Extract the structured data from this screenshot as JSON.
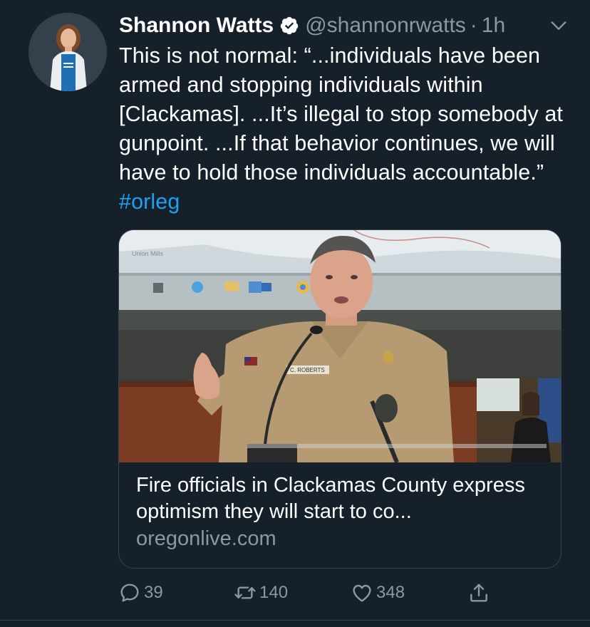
{
  "author": {
    "display_name": "Shannon Watts",
    "handle": "@shannonrwatts",
    "separator": "·",
    "time": "1h",
    "verified": true
  },
  "tweet": {
    "text_before": "This is not normal: “...individuals have been armed and stopping individuals within [Clackamas]. ...It’s illegal to stop somebody at gunpoint. ...If that behavior continues, we will have to hold those individuals accountable.” ",
    "hashtag": "#orleg"
  },
  "card": {
    "image_map_label": "Union Mills",
    "image_nametag": "C. ROBERTS",
    "title": "Fire officials in Clackamas County express optimism they will start to co...",
    "domain": "oregonlive.com"
  },
  "actions": {
    "replies": "39",
    "retweets": "140",
    "likes": "348"
  },
  "colors": {
    "background": "#15202b",
    "text": "#ffffff",
    "secondary": "#8899a6",
    "accent": "#1da1f2",
    "border": "#38444d"
  },
  "icons": [
    "verified-badge-icon",
    "chevron-down-icon",
    "reply-icon",
    "retweet-icon",
    "like-icon",
    "share-icon"
  ]
}
